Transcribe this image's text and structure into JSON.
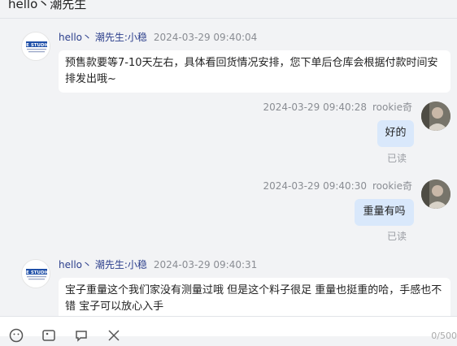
{
  "header": {
    "title": "hello丶潮先生"
  },
  "messages": [
    {
      "side": "in",
      "sender": "hello丶 潮先生:小稳",
      "time": "2024-03-29 09:40:04",
      "text": "预售款要等7-10天左右，具体看回货情况安排，您下单后仓库会根据付款时间安排发出哦~"
    },
    {
      "side": "out",
      "sender": "rookie奇",
      "time": "2024-03-29 09:40:28",
      "text": "好的",
      "status": "已读"
    },
    {
      "side": "out",
      "sender": "rookie奇",
      "time": "2024-03-29 09:40:30",
      "text": "重量有吗",
      "status": "已读"
    },
    {
      "side": "in",
      "sender": "hello丶 潮先生:小稳",
      "time": "2024-03-29 09:40:31",
      "text": "宝子重量这个我们家没有测量过哦  但是这个料子很足  重量也挺重的哈，手感也不错  宝子可以放心入手"
    }
  ],
  "toolbar": {
    "icons": [
      "emoji-icon",
      "image-icon",
      "quick-reply-icon",
      "scissors-icon"
    ],
    "counter": "0/500"
  }
}
